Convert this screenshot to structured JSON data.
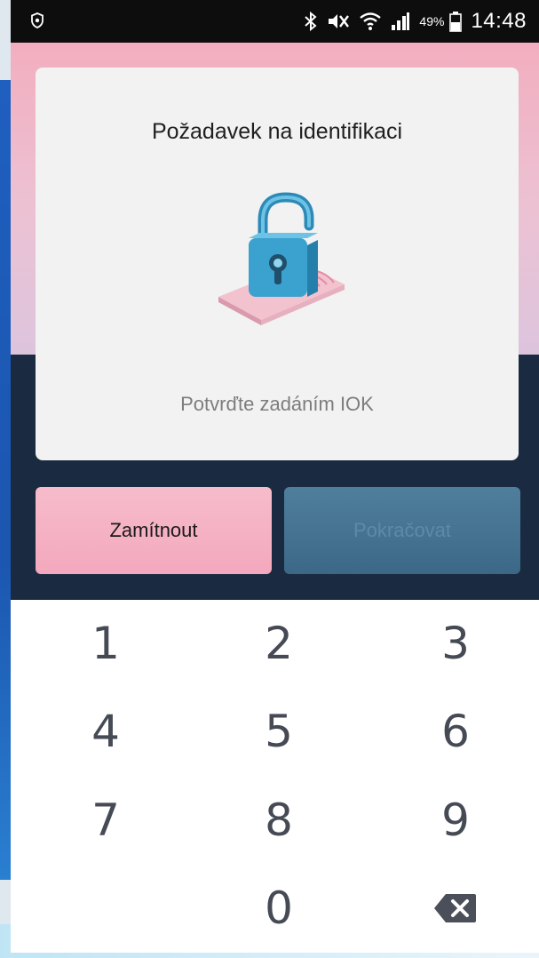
{
  "status_bar": {
    "icons": [
      "shield-icon",
      "bluetooth-icon",
      "mute-icon",
      "wifi-icon",
      "signal-icon",
      "battery-icon"
    ],
    "battery_percent": "49%",
    "time": "14:48"
  },
  "dialog": {
    "title": "Požadavek na identifikaci",
    "illustration": "padlock-on-id-card",
    "hint": "Potvrďte zadáním IOK"
  },
  "buttons": {
    "reject_label": "Zamítnout",
    "continue_label": "Pokračovat"
  },
  "keypad": {
    "keys": [
      "1",
      "2",
      "3",
      "4",
      "5",
      "6",
      "7",
      "8",
      "9",
      "0"
    ],
    "backspace_icon": "backspace-icon"
  },
  "colors": {
    "accent_pink": "#f4a8bd",
    "dark_navy": "#1a2a40",
    "continue_blue": "#3c6887"
  }
}
